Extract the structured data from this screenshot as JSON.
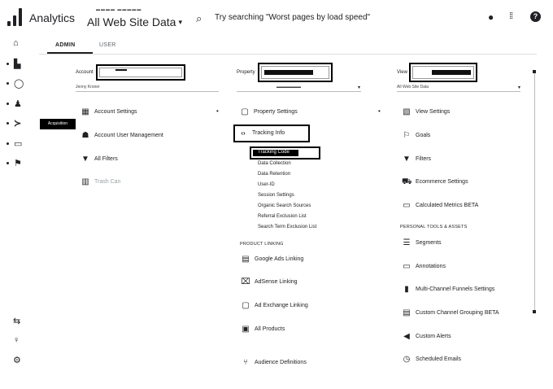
{
  "header": {
    "app_title": "Analytics",
    "account_crumb": "▬▬▬▬ ▬▬▬▬▬",
    "property_title": "All Web Site Data",
    "property_caret": "▾",
    "search_icon": "⌕",
    "search_placeholder": "Try searching \"Worst pages by load speed\"",
    "icons": {
      "notifications": "●",
      "apps": "⁞⁞",
      "help": "?"
    }
  },
  "rail": {
    "items": [
      {
        "name": "home-icon",
        "glyph": "⌂"
      },
      {
        "name": "customization-icon",
        "glyph": "▙"
      },
      {
        "name": "realtime-icon",
        "glyph": "◯"
      },
      {
        "name": "audience-icon",
        "glyph": "♟"
      },
      {
        "name": "acquisition-icon",
        "glyph": "≻"
      },
      {
        "name": "behavior-icon",
        "glyph": "▭"
      },
      {
        "name": "conversions-icon",
        "glyph": "⚑"
      }
    ],
    "badge": "Acquisition",
    "bottom": [
      {
        "name": "attribution-icon",
        "glyph": "⇆"
      },
      {
        "name": "discover-icon",
        "glyph": "♀"
      },
      {
        "name": "admin-gear-icon",
        "glyph": "⚙"
      }
    ]
  },
  "tabs": {
    "admin": "ADMIN",
    "user": "USER"
  },
  "account_col": {
    "label": "Account",
    "value": "Jenny Kroner",
    "items": [
      {
        "icon": "building-icon",
        "glyph": "▦",
        "label": "Account Settings"
      },
      {
        "icon": "users-icon",
        "glyph": "☗",
        "label": "Account User Management"
      },
      {
        "icon": "filter-icon",
        "glyph": "▼",
        "label": "All Filters"
      },
      {
        "icon": "trash-icon",
        "glyph": "▥",
        "label": "Trash Can"
      }
    ]
  },
  "property_col": {
    "label": "Property",
    "value": "▬▬▬▬▬▬",
    "items_top": [
      {
        "icon": "property-settings-icon",
        "glyph": "▢",
        "label": "Property Settings"
      },
      {
        "icon": "tracking-code-icon",
        "glyph": "‹›",
        "label": "Tracking Info"
      }
    ],
    "tracking_subitems": [
      "Tracking Code",
      "Data Collection",
      "Data Retention",
      "User-ID",
      "Session Settings",
      "Organic Search Sources",
      "Referral Exclusion List",
      "Search Term Exclusion List"
    ],
    "section_product_linking": "PRODUCT LINKING",
    "linking_items": [
      {
        "icon": "google-ads-icon",
        "glyph": "▤",
        "label": "Google Ads Linking"
      },
      {
        "icon": "adsense-icon",
        "glyph": "⌧",
        "label": "AdSense Linking"
      },
      {
        "icon": "adexchange-icon",
        "glyph": "▢",
        "label": "Ad Exchange Linking"
      },
      {
        "icon": "all-products-icon",
        "glyph": "▣",
        "label": "All Products"
      },
      {
        "icon": "audience-definitions-icon",
        "glyph": "⑂",
        "label": "Audience Definitions"
      }
    ]
  },
  "view_col": {
    "label": "View",
    "value": "All Web Site Data",
    "items": [
      {
        "icon": "view-settings-icon",
        "glyph": "▧",
        "label": "View Settings"
      },
      {
        "icon": "goals-icon",
        "glyph": "⚐",
        "label": "Goals"
      },
      {
        "icon": "filters-icon",
        "glyph": "▼",
        "label": "Filters"
      },
      {
        "icon": "ecommerce-icon",
        "glyph": "⛟",
        "label": "Ecommerce Settings"
      },
      {
        "icon": "calculated-metrics-icon",
        "glyph": "▭",
        "label": "Calculated Metrics BETA"
      }
    ],
    "section_personal": "PERSONAL TOOLS & ASSETS",
    "personal_items": [
      {
        "icon": "segments-icon",
        "glyph": "☰",
        "label": "Segments"
      },
      {
        "icon": "annotations-icon",
        "glyph": "▭",
        "label": "Annotations"
      },
      {
        "icon": "multichannel-icon",
        "glyph": "▮",
        "label": "Multi-Channel Funnels Settings"
      },
      {
        "icon": "channel-grouping-icon",
        "glyph": "▤",
        "label": "Custom Channel Grouping BETA"
      },
      {
        "icon": "custom-alerts-icon",
        "glyph": "◀",
        "label": "Custom Alerts"
      },
      {
        "icon": "scheduled-emails-icon",
        "glyph": "◷",
        "label": "Scheduled Emails"
      }
    ]
  }
}
